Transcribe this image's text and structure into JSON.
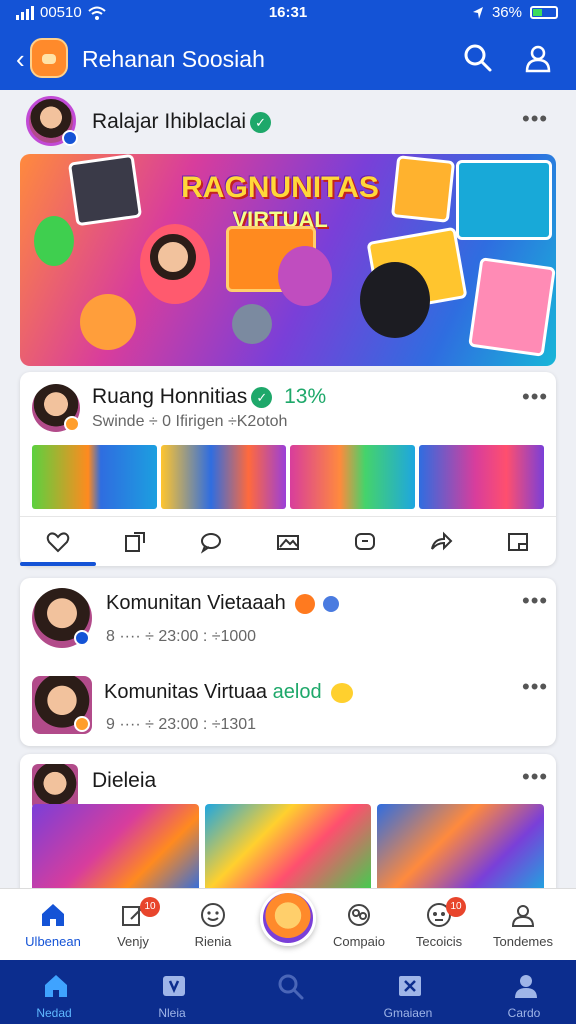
{
  "status_bar": {
    "carrier": "00510",
    "time": "16:31",
    "battery": "36%"
  },
  "app_bar": {
    "title": "Rehanan Soosiah"
  },
  "colors": {
    "primary": "#1453d6",
    "nav_dark": "#0c2d8e",
    "verified_green": "#1ea86a",
    "notification_red": "#e8452c"
  },
  "post": {
    "author": "Ralajar Ihiblaclai",
    "hero_title": "RAGNUNITAS",
    "hero_subtitle": "VIRTUAL"
  },
  "community_card": {
    "name": "Ruang Honnitias",
    "percent": "13%",
    "meta": "Swinde ÷ 0 Ifirigen ÷K2otoh",
    "actions": [
      "heart-icon",
      "share-square-icon",
      "comment-icon",
      "gallery-icon",
      "message-icon",
      "forward-icon",
      "bookmark-icon"
    ]
  },
  "list_card": {
    "items": [
      {
        "name": "Komunitan Vietaaah",
        "meta": "8 ···· ÷ 23:00 : ÷1000"
      },
      {
        "name": "Komunitas Virtuaa",
        "tag": "aelod",
        "meta": "9 ···· ÷ 23:00 : ÷1301"
      }
    ]
  },
  "gallery_card": {
    "title": "Dieleia"
  },
  "tabbar": {
    "tabs": [
      {
        "label": "Ulbenean",
        "icon": "home-icon",
        "badge": ""
      },
      {
        "label": "Venjy",
        "icon": "edit-icon",
        "badge": "10"
      },
      {
        "label": "Rienia",
        "icon": "smile-icon",
        "badge": ""
      },
      {
        "label": "Compaio",
        "icon": "group-icon",
        "badge": ""
      },
      {
        "label": "Tecoicis",
        "icon": "face-icon",
        "badge": "10"
      },
      {
        "label": "Tondemes",
        "icon": "profile-icon",
        "badge": ""
      }
    ]
  },
  "navbar": {
    "items": [
      {
        "label": "Nedad",
        "icon": "home-icon"
      },
      {
        "label": "Nleia",
        "icon": "video-icon"
      },
      {
        "label": "",
        "icon": "search-icon"
      },
      {
        "label": "Gmaiaen",
        "icon": "x-box-icon"
      },
      {
        "label": "Cardo",
        "icon": "user-icon"
      }
    ]
  }
}
